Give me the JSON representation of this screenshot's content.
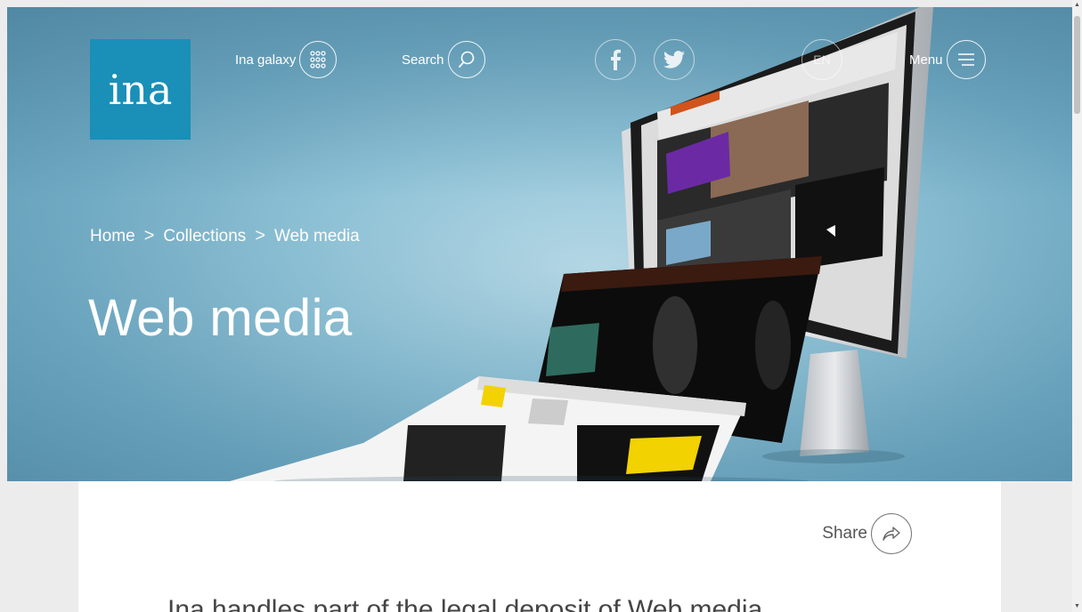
{
  "header": {
    "logo_text": "ina",
    "galaxy_label": "Ina galaxy",
    "search_label": "Search",
    "language_label": "EN",
    "menu_label": "Menu"
  },
  "breadcrumb": {
    "home": "Home",
    "collections": "Collections",
    "current": "Web media",
    "separator": ">"
  },
  "hero": {
    "title": "Web media"
  },
  "content": {
    "share_label": "Share",
    "lead": "Ina handles part of the legal deposit of Web media"
  },
  "colors": {
    "brand": "#1a8fb8",
    "hero_background": "#8fc2d6"
  }
}
